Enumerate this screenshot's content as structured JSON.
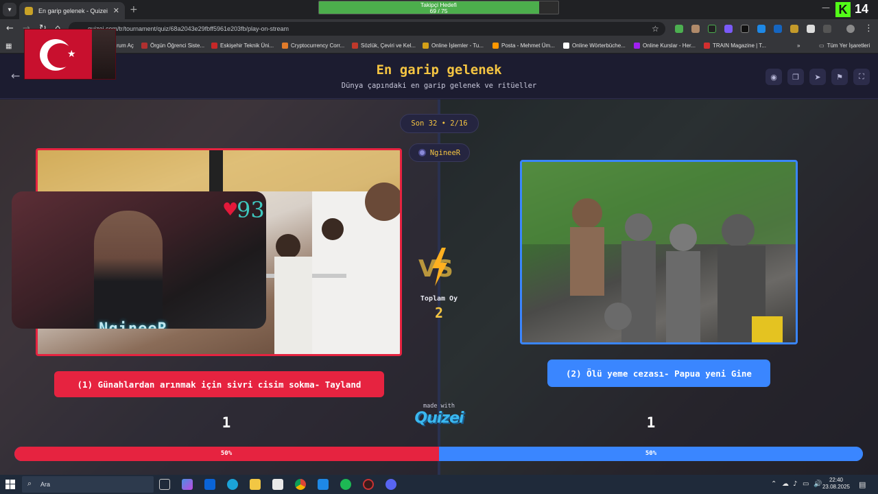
{
  "browser": {
    "tab_title": "En garip gelenek - Quizei",
    "url": "quizei.com/tr/tournament/quiz/68a2043e29fbff5961e203fb/play-on-stream",
    "bookmarks": [
      "rum Aç",
      "Örgün Öğrenci Siste...",
      "Eskişehir Teknik Üni...",
      "Cryptocurrency Corr...",
      "Sözlük, Çeviri ve Kel...",
      "Online İşlemler - Tu...",
      "Posta - Mehmet Üm...",
      "Online Wörterbüche...",
      "Online Kurslar - Her...",
      "TRAIN Magazine | T..."
    ],
    "all_bookmarks": "Tüm Yer İşaretleri"
  },
  "follower_goal": {
    "label": "Takipçi Hedefi",
    "value_text": "69 / 75",
    "progress": 0.92
  },
  "kick": {
    "logo": "K",
    "count": "14"
  },
  "quiz": {
    "title": "En garip gelenek",
    "subtitle": "Dünya çapındaki en garip gelenek ve ritüeller",
    "round": "Son 32 • 2/16",
    "streamer": "NgineeR",
    "total_votes_label": "Toplam Oy",
    "total_votes": "2",
    "made_with": "made with",
    "brand": "Quizei"
  },
  "options": {
    "left": {
      "label": "(1) Günahlardan arınmak için sivri cisim sokma- Tayland",
      "votes": "1",
      "percent_text": "50%",
      "share": 0.5,
      "color": "#e62340"
    },
    "right": {
      "label": "(2) Ölü yeme cezası- Papua yeni Gine",
      "votes": "1",
      "percent_text": "50%",
      "share": 0.5,
      "color": "#3a86ff"
    }
  },
  "webcam": {
    "heart_count": "93",
    "name": "NgineeR"
  },
  "taskbar": {
    "search_placeholder": "Ara",
    "time": "22:40",
    "date": "23.08.2025"
  }
}
